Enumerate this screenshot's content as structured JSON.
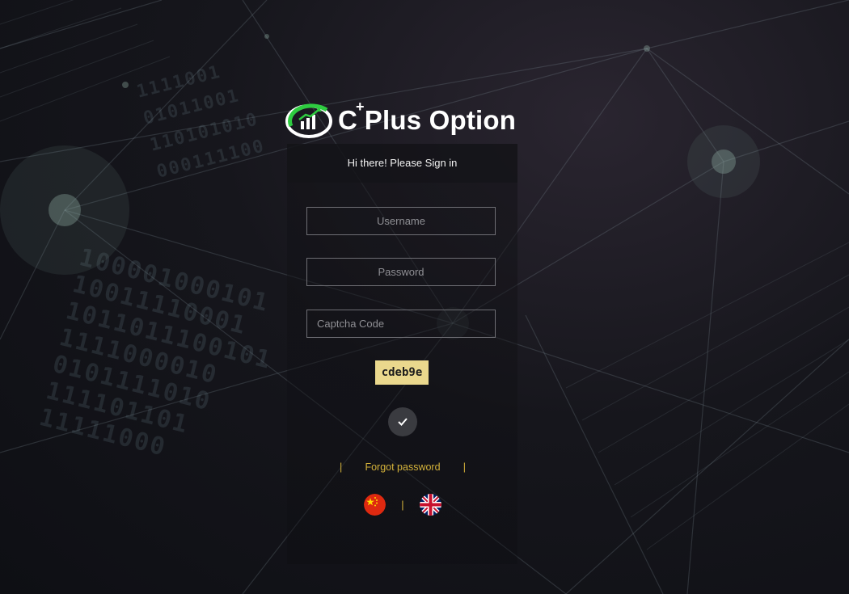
{
  "brand": {
    "name_prefix": "C",
    "name_sup": "+",
    "name_rest": "Plus Option",
    "accent": "#2ecc40"
  },
  "login": {
    "greeting": "Hi there! Please Sign in",
    "username_placeholder": "Username",
    "password_placeholder": "Password",
    "captcha_placeholder": "Captcha Code",
    "captcha_value": "cdeb9e",
    "submit_icon": "check-icon",
    "forgot_sep_left": "|",
    "forgot_label": "Forgot password",
    "forgot_sep_right": "|"
  },
  "languages": {
    "separator": "|",
    "items": [
      {
        "icon": "china-flag-icon"
      },
      {
        "icon": "uk-flag-icon"
      }
    ]
  },
  "colors": {
    "link": "#d4b23a",
    "captcha_bg": "#ead88d",
    "button_bg": "#3a3b40"
  }
}
